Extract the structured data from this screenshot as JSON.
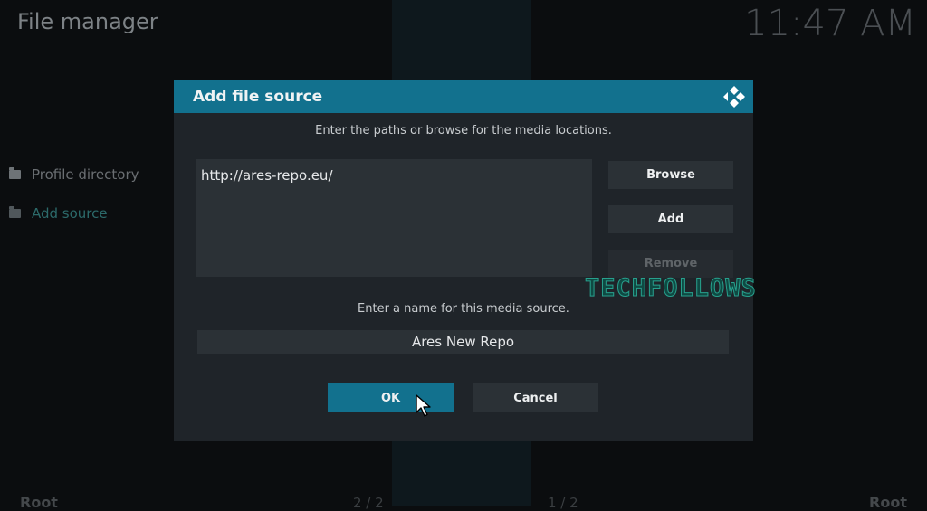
{
  "window": {
    "title": "File manager",
    "clock": "11:47 AM"
  },
  "sidebar": {
    "items": [
      {
        "label": "Profile directory",
        "icon": "folder-icon"
      },
      {
        "label": "Add source",
        "icon": "folder-icon"
      }
    ]
  },
  "footer": {
    "left_label": "Root",
    "right_label": "Root",
    "left_count": "2 / 2",
    "right_count": "1 / 2"
  },
  "dialog": {
    "title": "Add file source",
    "logo_icon": "kodi-logo-icon",
    "paths_instruction": "Enter the paths or browse for the media locations.",
    "paths": [
      "http://ares-repo.eu/"
    ],
    "browse_label": "Browse",
    "add_label": "Add",
    "remove_label": "Remove",
    "name_instruction": "Enter a name for this media source.",
    "name_value": "Ares New Repo",
    "ok_label": "OK",
    "cancel_label": "Cancel"
  },
  "watermark": "TECHFOLLOWS",
  "colors": {
    "accent": "#12718e",
    "dialog_bg": "#1f2429",
    "field_bg": "#2b3136"
  }
}
